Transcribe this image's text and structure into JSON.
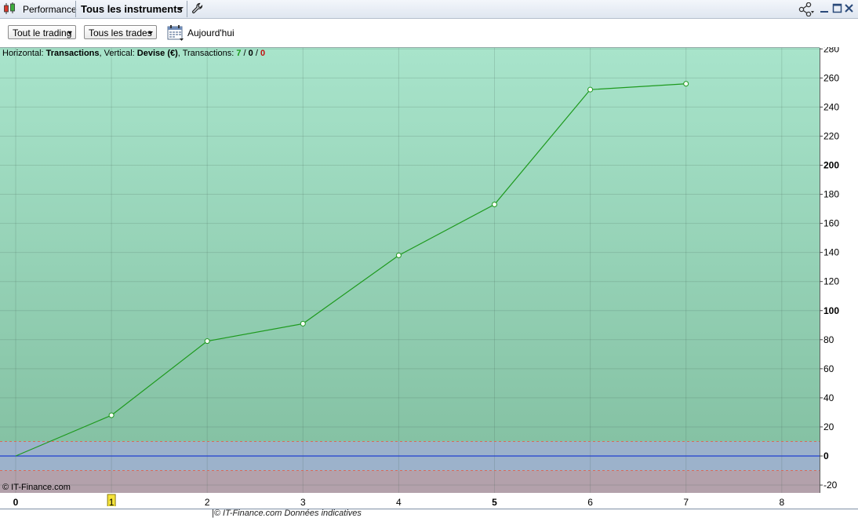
{
  "window": {
    "title": "Performance",
    "instrument_label": "Tous les instruments"
  },
  "toolbar": {
    "dropdown1": "Tout le trading",
    "dropdown2": "Tous les trades",
    "date_label": "Aujourd'hui"
  },
  "legend": {
    "h_prefix": "Horizontal: ",
    "h_value": "Transactions",
    "v_prefix": ", Vertical: ",
    "v_value": "Devise (€)",
    "t_prefix": ", Transactions: ",
    "count_win": "7",
    "sep1": " / ",
    "count_even": "0",
    "sep2": " / ",
    "count_loss": "0"
  },
  "copyright": "© IT-Finance.com",
  "bottom_text": "|© IT-Finance.com Données indicatives",
  "colors": {
    "bg_top": "#a8e4cb",
    "bg_bottom": "#85c2a4",
    "band_blue": "#9cb2cb",
    "band_red": "#b3a1ab",
    "line": "#1e9a1e",
    "zero_line": "#2040d0"
  },
  "chart_data": {
    "type": "line",
    "x": [
      0,
      1,
      2,
      3,
      4,
      5,
      6,
      7
    ],
    "values": [
      0,
      28,
      79,
      91,
      138,
      173,
      252,
      256
    ],
    "xlim": [
      0,
      8.4
    ],
    "ylim": [
      -25,
      283
    ],
    "xticks": [
      0,
      1,
      2,
      3,
      4,
      5,
      6,
      7,
      8
    ],
    "yticks": [
      -20,
      0,
      20,
      40,
      60,
      80,
      100,
      120,
      140,
      160,
      180,
      200,
      220,
      240,
      260,
      280
    ],
    "bold_xticks": [
      0,
      5
    ],
    "bold_yticks": [
      0,
      100,
      200
    ],
    "highlight_xtick": 1,
    "band": [
      -10,
      10
    ],
    "grid": true
  }
}
